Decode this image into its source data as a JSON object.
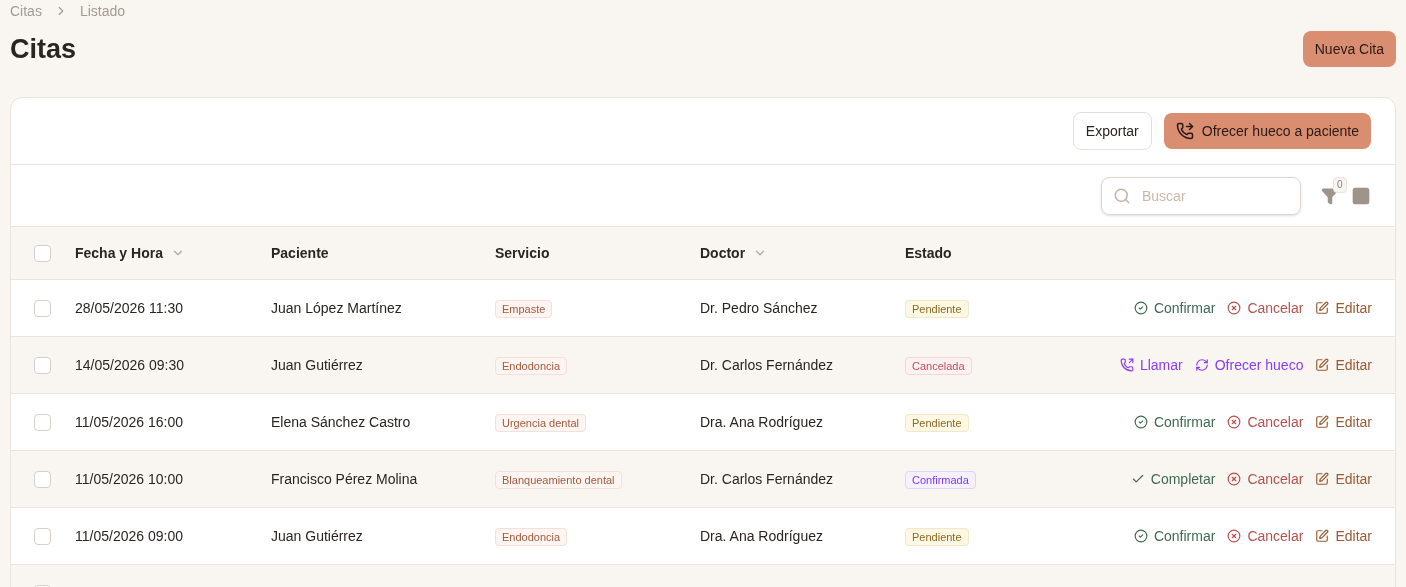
{
  "breadcrumb": [
    "Citas",
    "Listado"
  ],
  "title": "Citas",
  "new_button": "Nueva Cita",
  "toolbar": {
    "export": "Exportar",
    "offer": "Ofrecer hueco a paciente"
  },
  "search": {
    "placeholder": "Buscar"
  },
  "filter_count": "0",
  "table": {
    "select_all": {
      "checked": false
    },
    "columns": [
      {
        "label": "Fecha y Hora",
        "sortable": true
      },
      {
        "label": "Paciente",
        "sortable": false
      },
      {
        "label": "Servicio",
        "sortable": false
      },
      {
        "label": "Doctor",
        "sortable": true
      },
      {
        "label": "Estado",
        "sortable": false
      }
    ],
    "rows": [
      {
        "checked": false,
        "date": "28/05/2026 11:30",
        "patient": "Juan López Martínez",
        "service": "Empaste",
        "doctor": "Dr. Pedro Sánchez",
        "status": {
          "label": "Pendiente",
          "kind": "pending"
        },
        "actions": [
          {
            "kind": "confirm",
            "label": "Confirmar"
          },
          {
            "kind": "cancel",
            "label": "Cancelar"
          },
          {
            "kind": "edit",
            "label": "Editar"
          }
        ]
      },
      {
        "checked": false,
        "date": "14/05/2026 09:30",
        "patient": "Juan Gutiérrez",
        "service": "Endodoncia",
        "doctor": "Dr. Carlos Fernández",
        "status": {
          "label": "Cancelada",
          "kind": "cancelled"
        },
        "actions": [
          {
            "kind": "call",
            "label": "Llamar"
          },
          {
            "kind": "offer",
            "label": "Ofrecer hueco"
          },
          {
            "kind": "edit",
            "label": "Editar"
          }
        ]
      },
      {
        "checked": false,
        "date": "11/05/2026 16:00",
        "patient": "Elena Sánchez Castro",
        "service": "Urgencia dental",
        "doctor": "Dra. Ana Rodríguez",
        "status": {
          "label": "Pendiente",
          "kind": "pending"
        },
        "actions": [
          {
            "kind": "confirm",
            "label": "Confirmar"
          },
          {
            "kind": "cancel",
            "label": "Cancelar"
          },
          {
            "kind": "edit",
            "label": "Editar"
          }
        ]
      },
      {
        "checked": false,
        "date": "11/05/2026 10:00",
        "patient": "Francisco Pérez Molina",
        "service": "Blanqueamiento dental",
        "doctor": "Dr. Carlos Fernández",
        "status": {
          "label": "Confirmada",
          "kind": "confirmed"
        },
        "actions": [
          {
            "kind": "complete",
            "label": "Completar"
          },
          {
            "kind": "cancel",
            "label": "Cancelar"
          },
          {
            "kind": "edit",
            "label": "Editar"
          }
        ]
      },
      {
        "checked": false,
        "date": "11/05/2026 09:00",
        "patient": "Juan Gutiérrez",
        "service": "Endodoncia",
        "doctor": "Dra. Ana Rodríguez",
        "status": {
          "label": "Pendiente",
          "kind": "pending"
        },
        "actions": [
          {
            "kind": "confirm",
            "label": "Confirmar"
          },
          {
            "kind": "cancel",
            "label": "Cancelar"
          },
          {
            "kind": "edit",
            "label": "Editar"
          }
        ]
      }
    ]
  }
}
